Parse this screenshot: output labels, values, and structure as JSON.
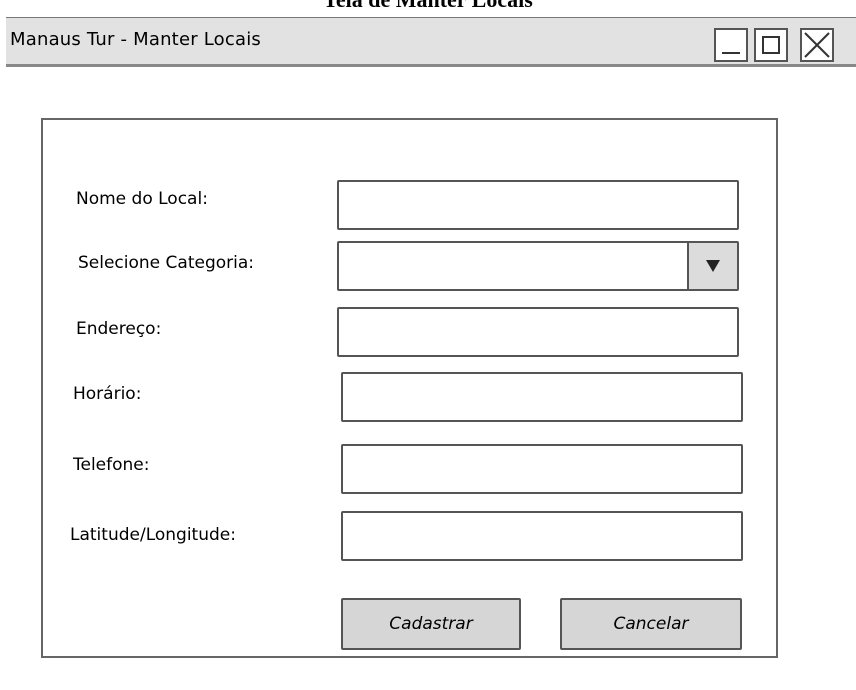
{
  "caption": "Tela de Manter Locais",
  "window": {
    "title": "Manaus Tur - Manter Locais"
  },
  "form": {
    "fields": [
      {
        "label": "Nome do Local:",
        "value": ""
      },
      {
        "label": "Selecione Categoria:",
        "value": ""
      },
      {
        "label": "Endereço:",
        "value": ""
      },
      {
        "label": "Horário:",
        "value": ""
      },
      {
        "label": "Telefone:",
        "value": ""
      },
      {
        "label": "Latitude/Longitude:",
        "value": ""
      }
    ],
    "buttons": {
      "submit": "Cadastrar",
      "cancel": "Cancelar"
    }
  },
  "icons": {
    "minimize": "minimize-icon",
    "maximize": "maximize-icon",
    "close": "close-icon",
    "dropdown": "triangle-down-icon"
  }
}
